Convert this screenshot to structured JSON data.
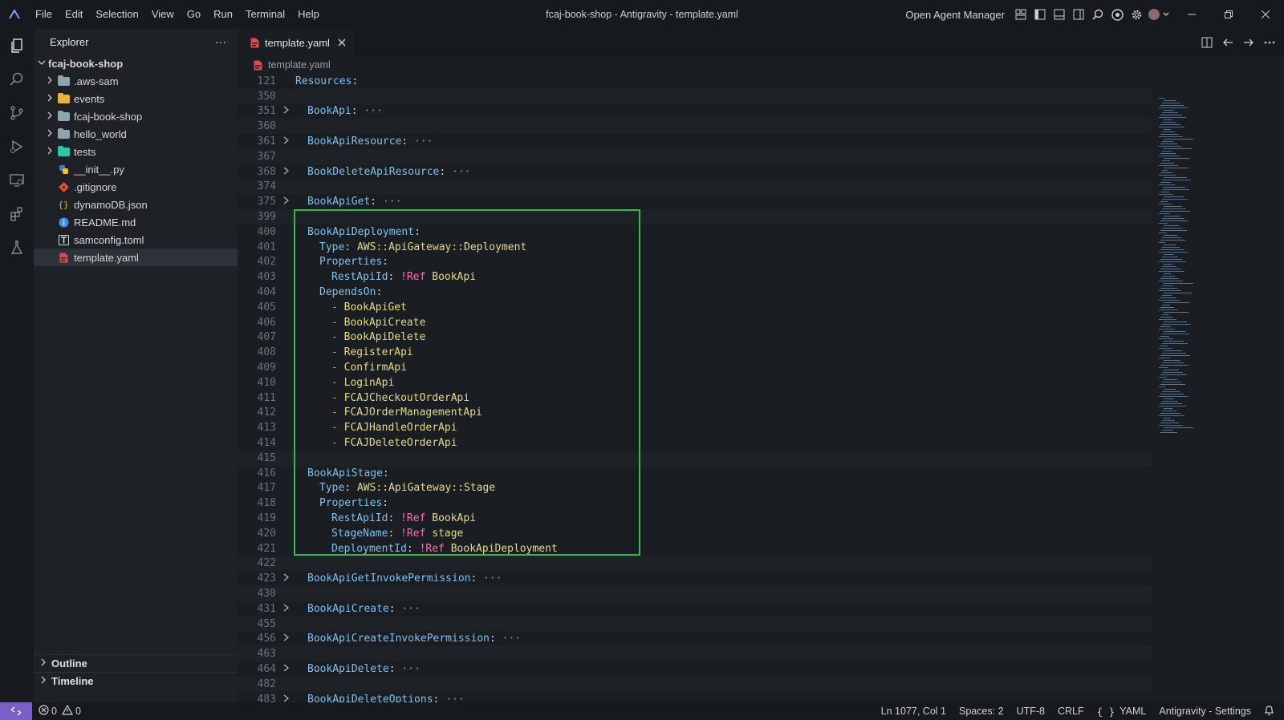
{
  "window": {
    "title": "fcaj-book-shop - Antigravity - template.yaml",
    "agent_manager": "Open Agent Manager",
    "menu": [
      "File",
      "Edit",
      "Selection",
      "View",
      "Go",
      "Run",
      "Terminal",
      "Help"
    ]
  },
  "sidebar": {
    "title": "Explorer",
    "more": "···",
    "root": "fcaj-book-shop",
    "items": [
      {
        "label": ".aws-sam",
        "type": "folder",
        "icon": "folder-icon"
      },
      {
        "label": "events",
        "type": "folder",
        "icon": "folder-yellow-icon"
      },
      {
        "label": "fcaj-book-shop",
        "type": "folder",
        "icon": "folder-icon"
      },
      {
        "label": "hello_world",
        "type": "folder",
        "icon": "folder-icon"
      },
      {
        "label": "tests",
        "type": "folder",
        "icon": "folder-teal-icon"
      },
      {
        "label": "__init__.py",
        "type": "file",
        "icon": "python-icon"
      },
      {
        "label": ".gitignore",
        "type": "file",
        "icon": "git-icon"
      },
      {
        "label": "dynamoDB.json",
        "type": "file",
        "icon": "json-icon"
      },
      {
        "label": "README.md",
        "type": "file",
        "icon": "info-icon"
      },
      {
        "label": "samconfig.toml",
        "type": "file",
        "icon": "toml-icon"
      },
      {
        "label": "template.yaml",
        "type": "file",
        "icon": "yaml-icon"
      }
    ],
    "outline": "Outline",
    "timeline": "Timeline"
  },
  "editor": {
    "tab": "template.yaml",
    "breadcrumb": "template.yaml",
    "lines": [
      {
        "n": "121",
        "fold": "",
        "indent": 0,
        "key": "Resources",
        "sep": ":",
        "val": "",
        "ell": false
      },
      {
        "n": "350",
        "fold": "",
        "indent": 0,
        "key": "",
        "sep": "",
        "val": "",
        "ell": false
      },
      {
        "n": "351",
        "fold": ">",
        "indent": 1,
        "key": "BookApi",
        "sep": ":",
        "val": "",
        "ell": true
      },
      {
        "n": "360",
        "fold": "",
        "indent": 0,
        "key": "",
        "sep": "",
        "val": "",
        "ell": false
      },
      {
        "n": "361",
        "fold": ">",
        "indent": 1,
        "key": "BookApiResource",
        "sep": ":",
        "val": "",
        "ell": true
      },
      {
        "n": "367",
        "fold": "",
        "indent": 0,
        "key": "",
        "sep": "",
        "val": "",
        "ell": false
      },
      {
        "n": "368",
        "fold": ">",
        "indent": 1,
        "key": "BookDeleteApiResource",
        "sep": ":",
        "val": "",
        "ell": true
      },
      {
        "n": "374",
        "fold": "",
        "indent": 0,
        "key": "",
        "sep": "",
        "val": "",
        "ell": false
      },
      {
        "n": "375",
        "fold": ">",
        "indent": 1,
        "key": "BookApiGet",
        "sep": ":",
        "val": "",
        "ell": true
      },
      {
        "n": "399",
        "fold": "",
        "indent": 0,
        "key": "",
        "sep": "",
        "val": "",
        "ell": false
      },
      {
        "n": "400",
        "fold": "",
        "indent": 1,
        "key": "BookApiDeployment",
        "sep": ":",
        "val": "",
        "ell": false
      },
      {
        "n": "401",
        "fold": "",
        "indent": 2,
        "key": "Type",
        "sep": ": ",
        "val": "AWS::ApiGateway::Deployment",
        "ell": false
      },
      {
        "n": "402",
        "fold": "",
        "indent": 2,
        "key": "Properties",
        "sep": ":",
        "val": "",
        "ell": false
      },
      {
        "n": "403",
        "fold": "",
        "indent": 3,
        "key": "RestApiId",
        "sep": ": ",
        "tag": "!Ref",
        "val": "BookApi",
        "ell": false
      },
      {
        "n": "404",
        "fold": "",
        "indent": 2,
        "key": "DependsOn",
        "sep": ":",
        "val": "",
        "ell": false
      },
      {
        "n": "405",
        "fold": "",
        "indent": 3,
        "dash": "- ",
        "val": "BookApiGet",
        "ell": false
      },
      {
        "n": "406",
        "fold": "",
        "indent": 3,
        "dash": "- ",
        "val": "BookApiCreate",
        "ell": false
      },
      {
        "n": "407",
        "fold": "",
        "indent": 3,
        "dash": "- ",
        "val": "BookApiDelete",
        "ell": false
      },
      {
        "n": "408",
        "fold": "",
        "indent": 3,
        "dash": "- ",
        "val": "RegisterApi",
        "ell": false
      },
      {
        "n": "409",
        "fold": "",
        "indent": 3,
        "dash": "- ",
        "val": "ConfirmApi",
        "ell": false
      },
      {
        "n": "410",
        "fold": "",
        "indent": 3,
        "dash": "- ",
        "val": "LoginApi",
        "ell": false
      },
      {
        "n": "411",
        "fold": "",
        "indent": 3,
        "dash": "- ",
        "val": "FCAJCheckoutOrderApi",
        "ell": false
      },
      {
        "n": "412",
        "fold": "",
        "indent": 3,
        "dash": "- ",
        "val": "FCAJOrderManagementApi",
        "ell": false
      },
      {
        "n": "413",
        "fold": "",
        "indent": 3,
        "dash": "- ",
        "val": "FCAJHandleOrderApi",
        "ell": false
      },
      {
        "n": "414",
        "fold": "",
        "indent": 3,
        "dash": "- ",
        "val": "FCAJDeleteOrderApi",
        "ell": false
      },
      {
        "n": "415",
        "fold": "",
        "indent": 0,
        "key": "",
        "sep": "",
        "val": "",
        "ell": false
      },
      {
        "n": "416",
        "fold": "",
        "indent": 1,
        "key": "BookApiStage",
        "sep": ":",
        "val": "",
        "ell": false
      },
      {
        "n": "417",
        "fold": "",
        "indent": 2,
        "key": "Type",
        "sep": ": ",
        "val": "AWS::ApiGateway::Stage",
        "ell": false
      },
      {
        "n": "418",
        "fold": "",
        "indent": 2,
        "key": "Properties",
        "sep": ":",
        "val": "",
        "ell": false
      },
      {
        "n": "419",
        "fold": "",
        "indent": 3,
        "key": "RestApiId",
        "sep": ": ",
        "tag": "!Ref",
        "val": "BookApi",
        "ell": false
      },
      {
        "n": "420",
        "fold": "",
        "indent": 3,
        "key": "StageName",
        "sep": ": ",
        "tag": "!Ref",
        "val": "stage",
        "ell": false
      },
      {
        "n": "421",
        "fold": "",
        "indent": 3,
        "key": "DeploymentId",
        "sep": ": ",
        "tag": "!Ref",
        "val": "BookApiDeployment",
        "ell": false
      },
      {
        "n": "422",
        "fold": "",
        "indent": 0,
        "key": "",
        "sep": "",
        "val": "",
        "ell": false
      },
      {
        "n": "423",
        "fold": ">",
        "indent": 1,
        "key": "BookApiGetInvokePermission",
        "sep": ":",
        "val": "",
        "ell": true
      },
      {
        "n": "430",
        "fold": "",
        "indent": 0,
        "key": "",
        "sep": "",
        "val": "",
        "ell": false
      },
      {
        "n": "431",
        "fold": ">",
        "indent": 1,
        "key": "BookApiCreate",
        "sep": ":",
        "val": "",
        "ell": true
      },
      {
        "n": "455",
        "fold": "",
        "indent": 0,
        "key": "",
        "sep": "",
        "val": "",
        "ell": false
      },
      {
        "n": "456",
        "fold": ">",
        "indent": 1,
        "key": "BookApiCreateInvokePermission",
        "sep": ":",
        "val": "",
        "ell": true
      },
      {
        "n": "463",
        "fold": "",
        "indent": 0,
        "key": "",
        "sep": "",
        "val": "",
        "ell": false
      },
      {
        "n": "464",
        "fold": ">",
        "indent": 1,
        "key": "BookApiDelete",
        "sep": ":",
        "val": "",
        "ell": true
      },
      {
        "n": "482",
        "fold": "",
        "indent": 0,
        "key": "",
        "sep": "",
        "val": "",
        "ell": false
      },
      {
        "n": "483",
        "fold": ">",
        "indent": 1,
        "key": "BookApiDeleteOptions",
        "sep": ":",
        "val": "",
        "ell": true
      }
    ]
  },
  "status": {
    "errors": "0",
    "warnings": "0",
    "position": "Ln 1077, Col 1",
    "spaces": "Spaces: 2",
    "encoding": "UTF-8",
    "eol": "CRLF",
    "language": "YAML",
    "settings": "Antigravity - Settings"
  },
  "colors": {
    "highlight_box": "#2fbd4e",
    "remote_indicator": "#7b5fc7",
    "yaml_key": "#7fc1ef",
    "yaml_value": "#e5d98a",
    "yaml_tag": "#f472b6"
  }
}
